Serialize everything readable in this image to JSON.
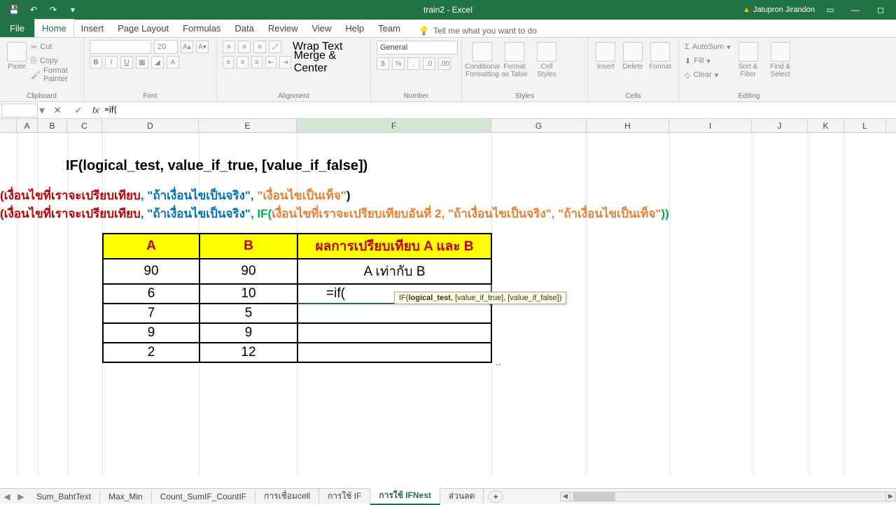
{
  "titlebar": {
    "title": "train2 - Excel",
    "user": "Jatupron Jirandon"
  },
  "tabs": {
    "file": "File",
    "home": "Home",
    "insert": "Insert",
    "pagelayout": "Page Layout",
    "formulas": "Formulas",
    "data": "Data",
    "review": "Review",
    "view": "View",
    "help": "Help",
    "team": "Team",
    "tellme": "Tell me what you want to do"
  },
  "ribbon": {
    "clipboard": {
      "label": "Clipboard",
      "cut": "Cut",
      "copy": "Copy",
      "painter": "Format Painter",
      "paste": "Paste"
    },
    "font": {
      "label": "Font",
      "size": "20"
    },
    "alignment": {
      "label": "Alignment",
      "wrap": "Wrap Text",
      "merge": "Merge & Center"
    },
    "number": {
      "label": "Number",
      "fmt": "General"
    },
    "styles": {
      "label": "Styles",
      "cond": "Conditional Formatting",
      "table": "Format as Table",
      "cell": "Cell Styles"
    },
    "cells": {
      "label": "Cells",
      "insert": "Insert",
      "delete": "Delete",
      "format": "Format"
    },
    "editing": {
      "label": "Editing",
      "autosum": "AutoSum",
      "fill": "Fill",
      "clear": "Clear",
      "sort": "Sort & Filter",
      "find": "Find & Select"
    }
  },
  "formulabar": {
    "namebox": "",
    "value": "=if("
  },
  "columns": [
    "A",
    "B",
    "C",
    "D",
    "E",
    "F",
    "G",
    "H",
    "I",
    "J",
    "K",
    "L"
  ],
  "content": {
    "syntax": "IF(logical_test, value_if_true, [value_if_false])",
    "line1": {
      "p1": "(เงื่อนไขที่เราจะเปรียบเทียบ",
      "p2": ", \"ถ้าเงื่อนไขเป็นจริง\", ",
      "p3": "\"เงื่อนไขเป็นเท็จ\"",
      "p4": ")"
    },
    "line2": {
      "p1": "(เงื่อนไขที่เราจะเปรียบเทียบ",
      "p2": ", \"ถ้าเงื่อนไขเป็นจริง\", ",
      "p3": "IF(",
      "p4": "เงื่อนไขที่เราจะเปรียบเทียบอันที่ 2, \"ถ้าเงื่อนไขเป็นจริง\", \"ถ้าเงื่อนไขเป็นเท็จ\"",
      "p5": "))"
    }
  },
  "table": {
    "hdr_a": "A",
    "hdr_b": "B",
    "hdr_r": "ผลการเปรียบเทียบ A และ B",
    "rows": [
      {
        "a": "90",
        "b": "90",
        "r": "A เท่ากับ B"
      },
      {
        "a": "6",
        "b": "10",
        "r": "=if("
      },
      {
        "a": "7",
        "b": "5",
        "r": ""
      },
      {
        "a": "9",
        "b": "9",
        "r": ""
      },
      {
        "a": "2",
        "b": "12",
        "r": ""
      }
    ]
  },
  "tooltip": {
    "fn": "IF(",
    "logical": "logical_test",
    "rest": ", [value_if_true], [value_if_false])"
  },
  "sheets": {
    "s1": "Sum_BahtText",
    "s2": "Max_Min",
    "s3": "Count_SumIF_CountIF",
    "s4": "การเชื่อมcell",
    "s5": "การใช้ IF",
    "s6": "การใช้ IFNest",
    "s7": "ส่วนลด"
  }
}
